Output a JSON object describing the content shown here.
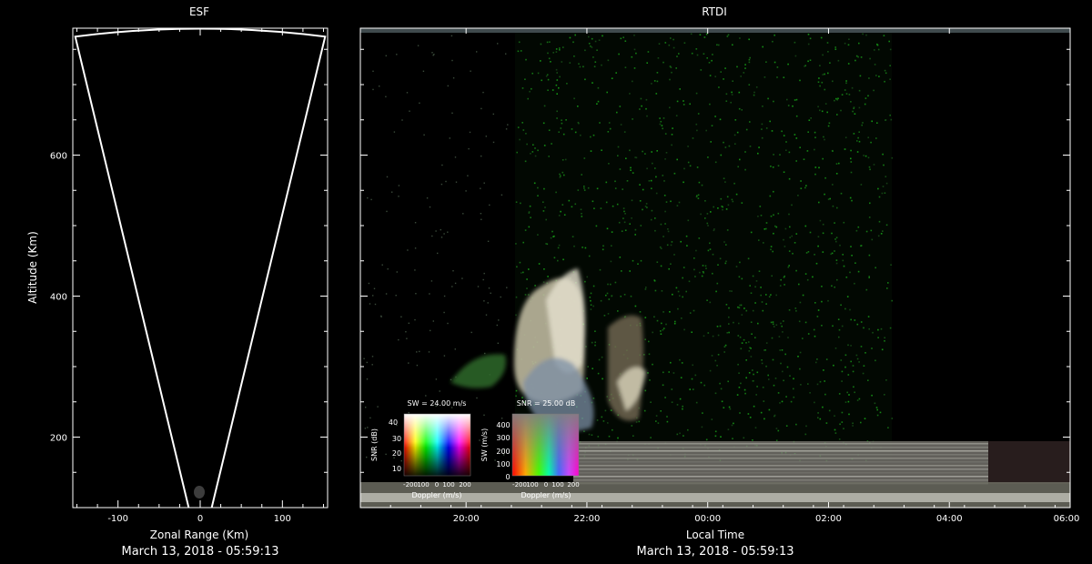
{
  "chart_data": [
    {
      "type": "scatter",
      "title": "ESF",
      "xlabel": "Zonal Range (Km)",
      "ylabel": "Altitude (Km)",
      "xlim": [
        -155,
        155
      ],
      "ylim": [
        100,
        780
      ],
      "x_ticks": [
        -100,
        0,
        100
      ],
      "y_ticks": [
        200,
        400,
        600
      ],
      "x_tick_labels": [
        "-100",
        "0",
        "100"
      ],
      "y_tick_labels": [
        "200",
        "400",
        "600"
      ],
      "date_caption": "March 13, 2018 - 05:59:13",
      "outline_color": "#ffffff",
      "fan_outline": [
        [
          -14,
          100
        ],
        [
          -152,
          768
        ],
        [
          0,
          780
        ],
        [
          152,
          768
        ],
        [
          14,
          100
        ]
      ]
    },
    {
      "type": "heatmap",
      "title": "RTDI",
      "xlabel": "Local Time",
      "ylabel": "",
      "xlim": [
        "18:15",
        "06:00"
      ],
      "ylim": [
        100,
        780
      ],
      "x_tick_labels": [
        "20:00",
        "22:00",
        "00:00",
        "02:00",
        "04:00",
        "06:00"
      ],
      "x_tick_values": [
        "20:00",
        "22:00",
        "00:00",
        "02:00",
        "04:00",
        "06:00"
      ],
      "date_caption": "March 13, 2018 - 05:59:13",
      "legends": [
        {
          "title": "SW = 24.00 m/s",
          "xlabel": "Doppler (m/s)",
          "ylabel": "SNR (dB)",
          "x_tick_labels": [
            "-200",
            "100",
            "0",
            "100",
            "200"
          ],
          "y_tick_labels": [
            "40",
            "30",
            "20",
            "10"
          ]
        },
        {
          "title": "SNR = 25.00 dB",
          "xlabel": "Doppler (m/s)",
          "ylabel": "SW (m/s)",
          "x_tick_labels": [
            "-200",
            "100",
            "0",
            "100",
            "200"
          ],
          "y_tick_labels": [
            "400",
            "300",
            "200",
            "100",
            "0"
          ]
        }
      ]
    }
  ]
}
